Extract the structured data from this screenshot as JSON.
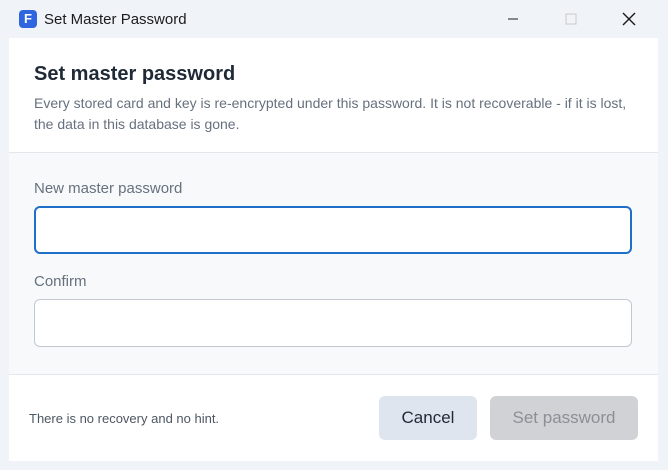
{
  "window": {
    "title": "Set Master Password",
    "app_icon_letter": "F"
  },
  "dialog": {
    "title": "Set master password",
    "description": "Every stored card and key is re-encrypted under this password. It is not recoverable - if it is lost, the data in this database is gone."
  },
  "fields": {
    "new_password": {
      "label": "New master password",
      "value": "",
      "placeholder": ""
    },
    "confirm": {
      "label": "Confirm",
      "value": "",
      "placeholder": ""
    }
  },
  "footer": {
    "note": "There is no recovery and no hint.",
    "cancel_label": "Cancel",
    "submit_label": "Set password"
  },
  "colors": {
    "accent": "#1f6fc8",
    "app_icon": "#2f66e0",
    "disabled_button": "#d0d2d6",
    "secondary_button": "#dfe5ee"
  },
  "icons": {
    "minimize": "minimize-icon",
    "maximize": "maximize-icon",
    "close": "close-icon"
  }
}
